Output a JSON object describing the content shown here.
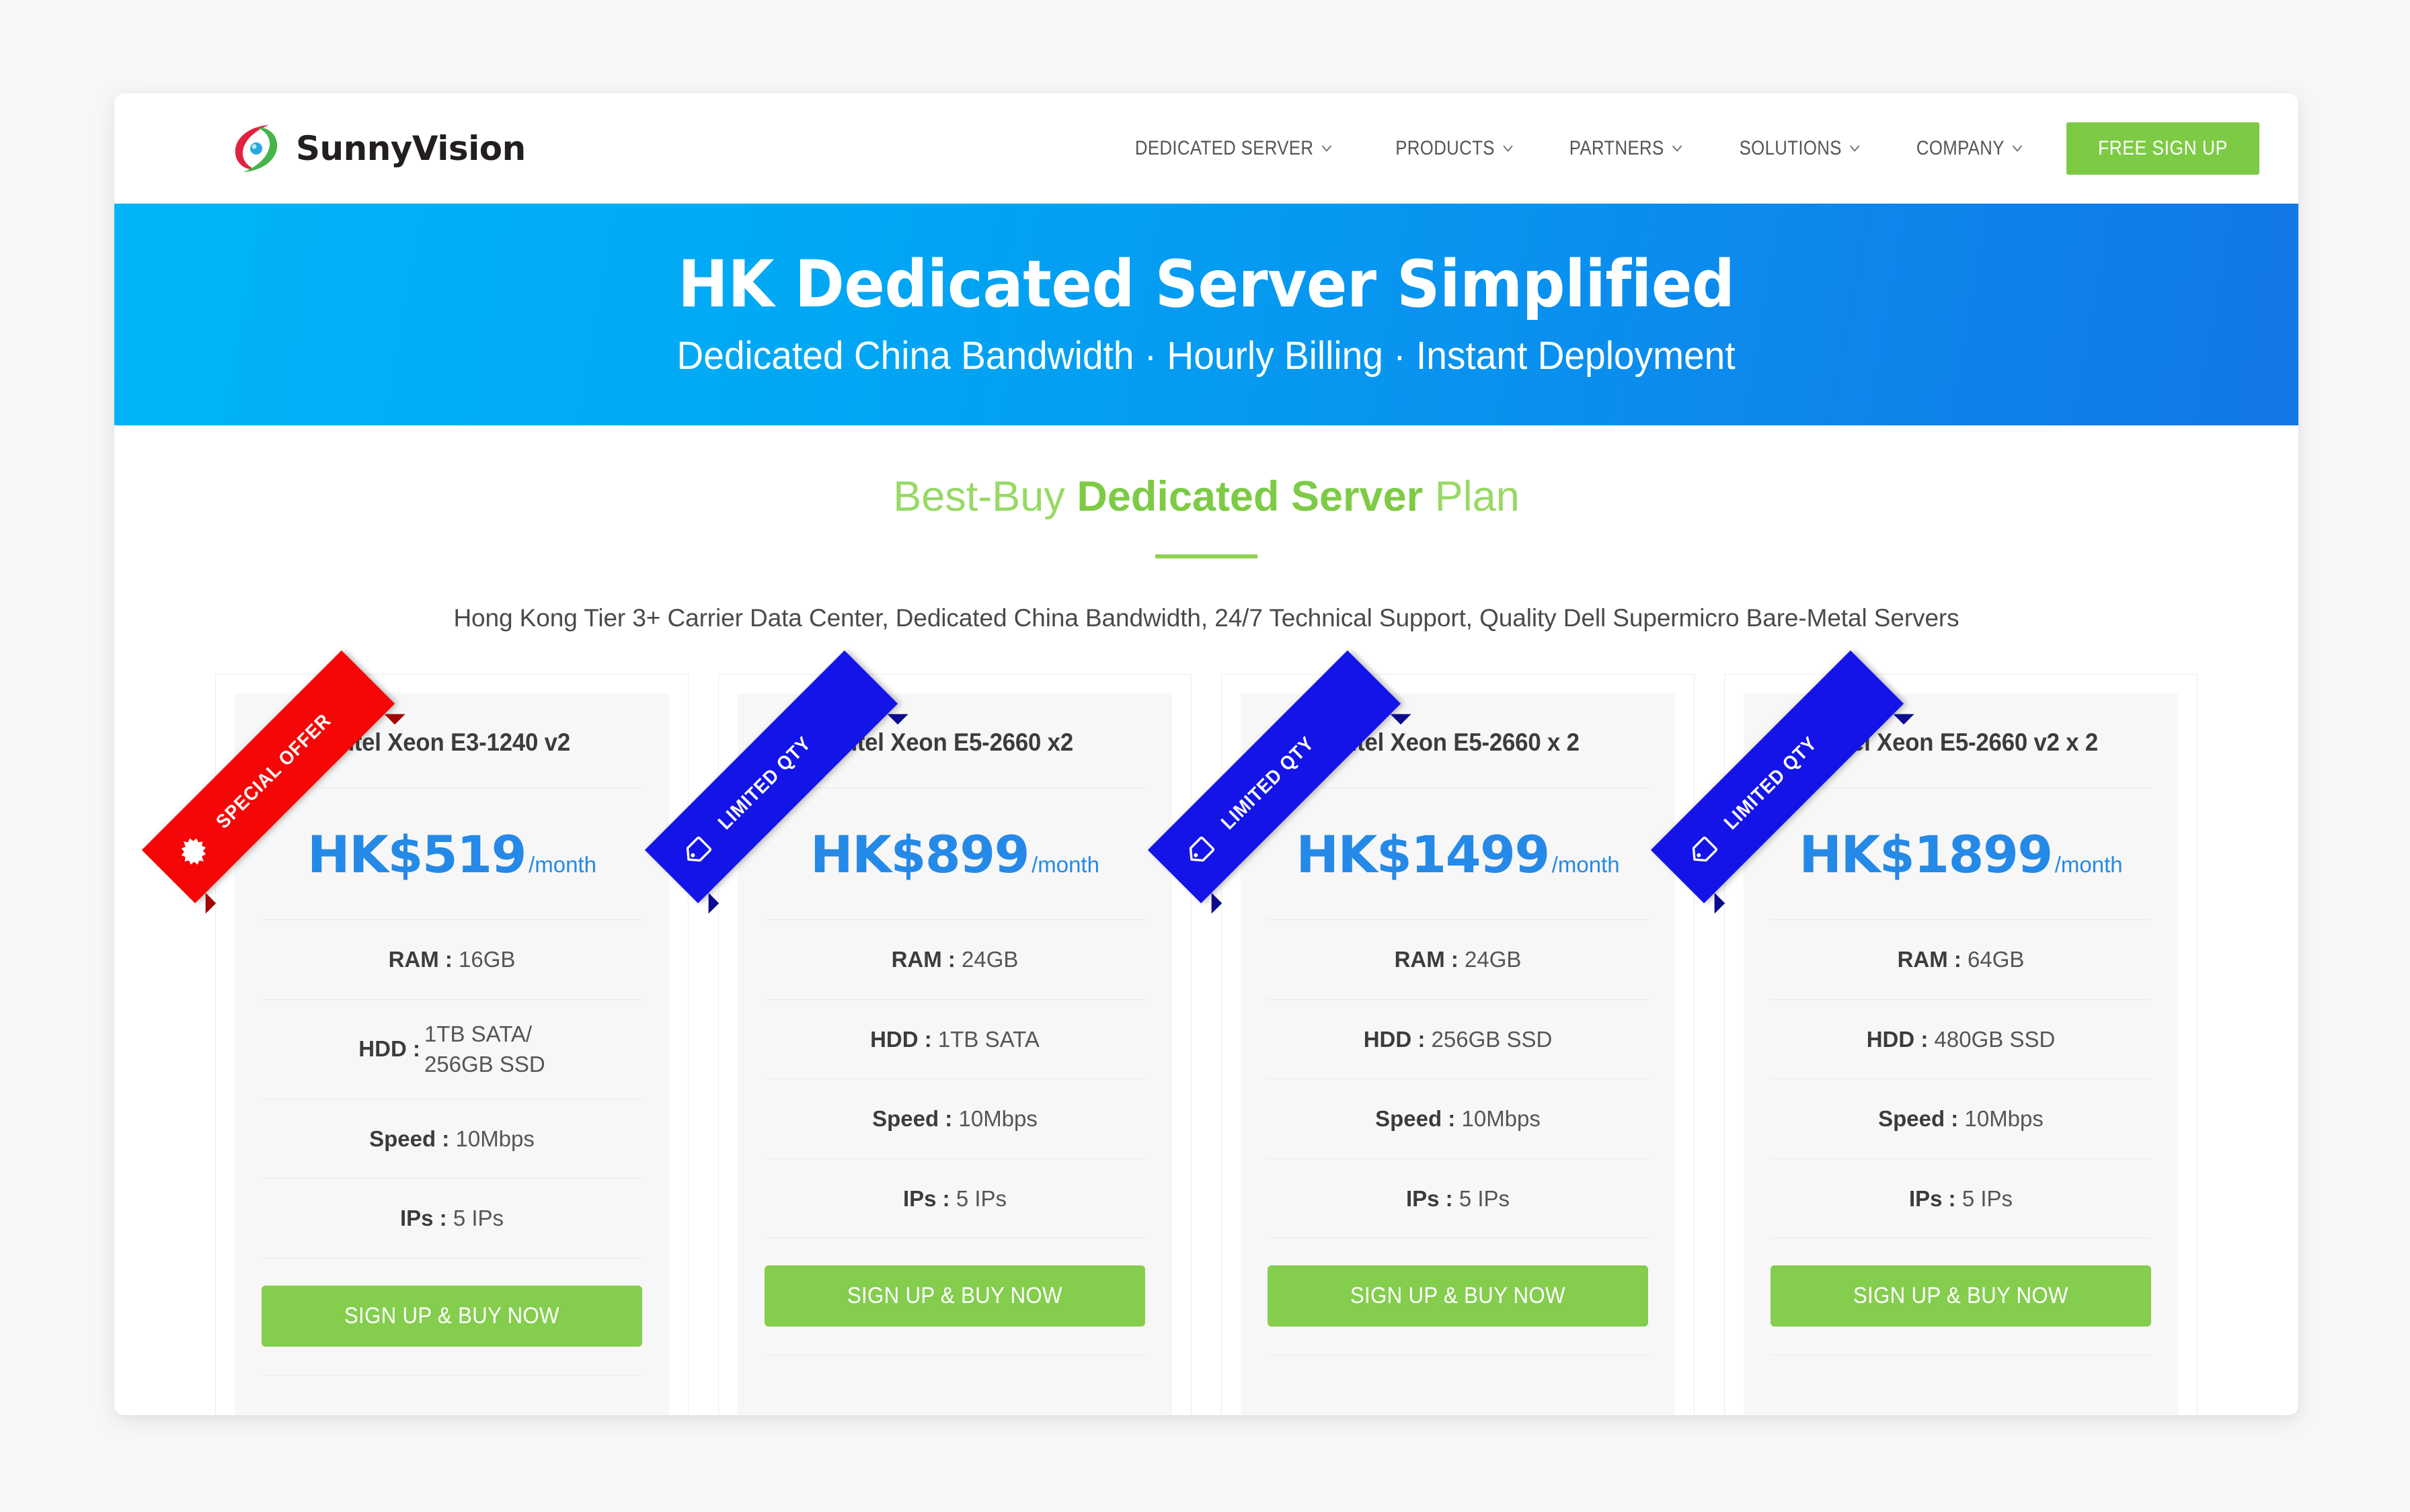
{
  "header": {
    "logo": {
      "icon": "sunnyvision-swirl-logo-icon",
      "text": "SunnyVision"
    },
    "nav": [
      {
        "label": "DEDICATED SERVER",
        "has_dropdown": true
      },
      {
        "label": "PRODUCTS",
        "has_dropdown": true
      },
      {
        "label": "PARTNERS",
        "has_dropdown": true
      },
      {
        "label": "SOLUTIONS",
        "has_dropdown": true
      },
      {
        "label": "COMPANY",
        "has_dropdown": true
      }
    ],
    "signup_label": "FREE SIGN UP"
  },
  "hero": {
    "title": "HK Dedicated Server Simplified",
    "subtitle": "Dedicated China Bandwidth · Hourly Billing · Instant Deployment",
    "gradient_from": "#00b4f7",
    "gradient_to": "#1277e6"
  },
  "section": {
    "title_pre": "Best-Buy ",
    "title_strong": "Dedicated Server",
    "title_post": " Plan",
    "subtitle": "Hong Kong Tier 3+ Carrier Data Center, Dedicated China Bandwidth, 24/7 Technical Support, Quality Dell Supermicro Bare-Metal Servers",
    "accent_green": "#7dcb45",
    "accent_green_light": "#97d964"
  },
  "plans": [
    {
      "ribbon": {
        "label": "SPECIAL OFFER",
        "color": "#f60606",
        "style": "red",
        "icon": "starburst-badge-icon"
      },
      "title": "Intel Xeon E3-1240 v2",
      "price": "HK$519",
      "price_period": "/month",
      "specs": [
        {
          "key": "RAM :",
          "value": "16GB",
          "stacked": false
        },
        {
          "key": "HDD :",
          "value": "1TB SATA/\n256GB SSD",
          "stacked": true
        },
        {
          "key": "Speed :",
          "value": "10Mbps",
          "stacked": false
        },
        {
          "key": "IPs :",
          "value": "5 IPs",
          "stacked": false
        }
      ],
      "cta": "SIGN UP & BUY NOW"
    },
    {
      "ribbon": {
        "label": "LIMITED QTY",
        "color": "#1414e8",
        "style": "blue",
        "icon": "price-tag-icon"
      },
      "title": "Intel Xeon E5-2660 x2",
      "price": "HK$899",
      "price_period": "/month",
      "specs": [
        {
          "key": "RAM :",
          "value": "24GB",
          "stacked": false
        },
        {
          "key": "HDD :",
          "value": "1TB SATA",
          "stacked": false
        },
        {
          "key": "Speed :",
          "value": "10Mbps",
          "stacked": false
        },
        {
          "key": "IPs :",
          "value": "5 IPs",
          "stacked": false
        }
      ],
      "cta": "SIGN UP & BUY NOW"
    },
    {
      "ribbon": {
        "label": "LIMITED QTY",
        "color": "#1414e8",
        "style": "blue",
        "icon": "price-tag-icon"
      },
      "title": "Intel Xeon E5-2660 x 2",
      "price": "HK$1499",
      "price_period": "/month",
      "specs": [
        {
          "key": "RAM :",
          "value": "24GB",
          "stacked": false
        },
        {
          "key": "HDD :",
          "value": "256GB SSD",
          "stacked": false
        },
        {
          "key": "Speed :",
          "value": "10Mbps",
          "stacked": false
        },
        {
          "key": "IPs :",
          "value": "5 IPs",
          "stacked": false
        }
      ],
      "cta": "SIGN UP & BUY NOW"
    },
    {
      "ribbon": {
        "label": "LIMITED QTY",
        "color": "#1414e8",
        "style": "blue",
        "icon": "price-tag-icon"
      },
      "title": "Intel Xeon E5-2660 v2 x 2",
      "price": "HK$1899",
      "price_period": "/month",
      "specs": [
        {
          "key": "RAM :",
          "value": "64GB",
          "stacked": false
        },
        {
          "key": "HDD :",
          "value": "480GB SSD",
          "stacked": false
        },
        {
          "key": "Speed :",
          "value": "10Mbps",
          "stacked": false
        },
        {
          "key": "IPs :",
          "value": "5 IPs",
          "stacked": false
        }
      ],
      "cta": "SIGN UP & BUY NOW"
    }
  ]
}
